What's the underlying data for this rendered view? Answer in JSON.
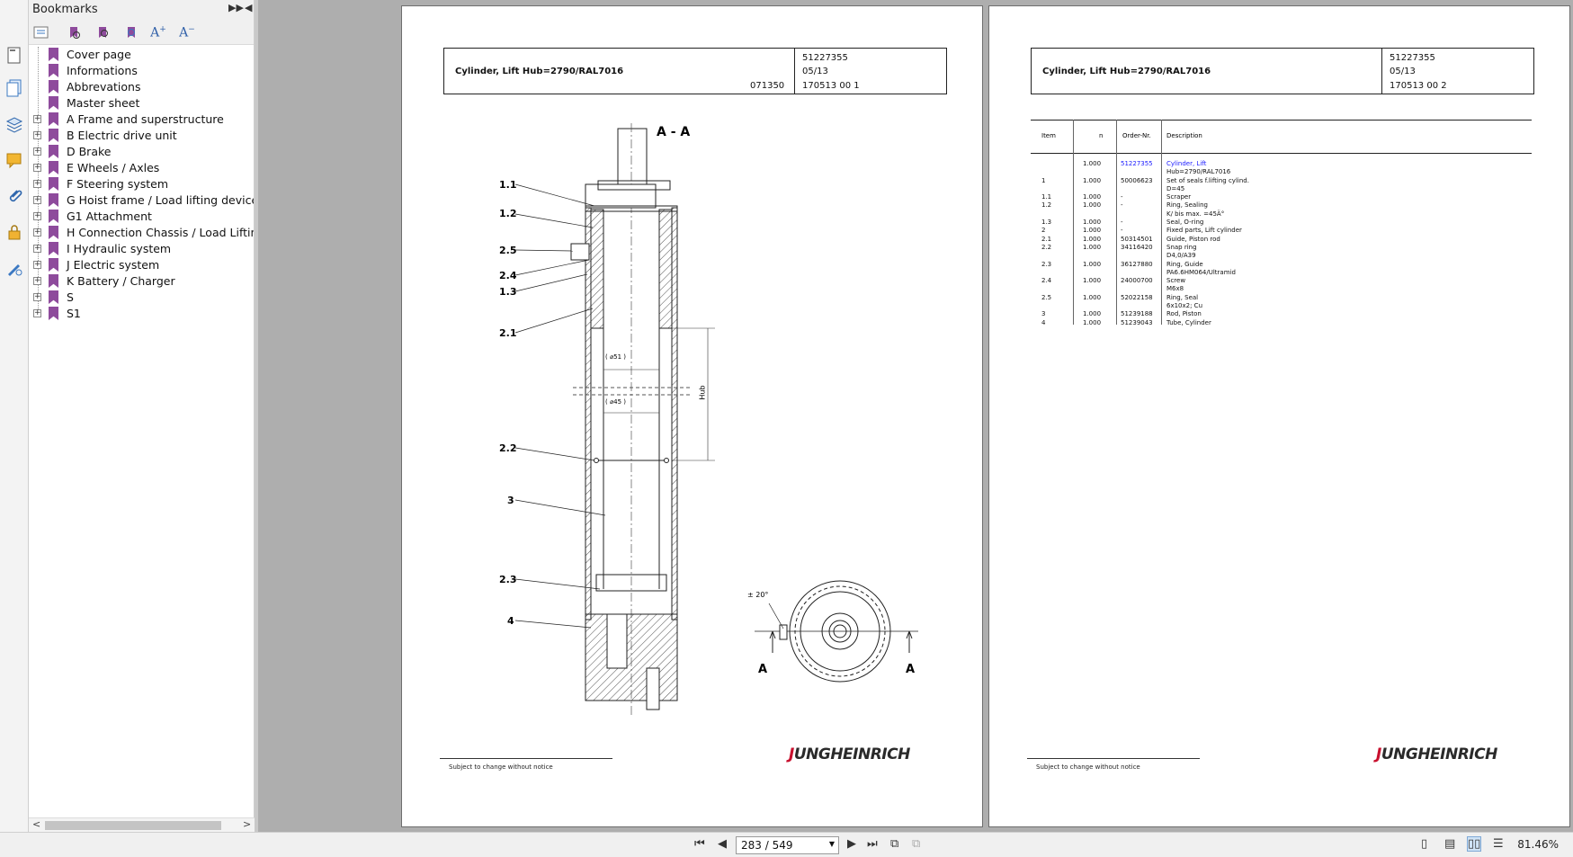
{
  "panel": {
    "title": "Bookmarks"
  },
  "bookmarks": [
    {
      "label": "Cover page",
      "expandable": false
    },
    {
      "label": "Informations",
      "expandable": false
    },
    {
      "label": "Abbrevations",
      "expandable": false
    },
    {
      "label": "Master sheet",
      "expandable": false
    },
    {
      "label": "A Frame and superstructure",
      "expandable": true
    },
    {
      "label": "B Electric drive unit",
      "expandable": true
    },
    {
      "label": "D Brake",
      "expandable": true
    },
    {
      "label": "E Wheels / Axles",
      "expandable": true
    },
    {
      "label": "F Steering system",
      "expandable": true
    },
    {
      "label": "G Hoist frame / Load lifting device",
      "expandable": true
    },
    {
      "label": "G1 Attachment",
      "expandable": true
    },
    {
      "label": "H Connection Chassis / Load Lifting De",
      "expandable": true
    },
    {
      "label": "I Hydraulic system",
      "expandable": true
    },
    {
      "label": "J Electric system",
      "expandable": true
    },
    {
      "label": "K Battery / Charger",
      "expandable": true
    },
    {
      "label": "S",
      "expandable": true
    },
    {
      "label": "S1",
      "expandable": true
    }
  ],
  "left_page": {
    "title": "Cylinder, Lift Hub=2790/RAL7016",
    "code_left": "071350",
    "part_no": "51227355",
    "date": "05/13",
    "sheet": "170513 00 1",
    "section": "A - A",
    "callouts": [
      "1.1",
      "1.2",
      "2.5",
      "2.4",
      "1.3",
      "2.1",
      "2.2",
      "3",
      "2.3",
      "4"
    ],
    "dim_51": "( ⌀51 )",
    "dim_45": "( ⌀45 )",
    "dim_hub": "Hub",
    "angle": "± 20°",
    "cut_a": "A",
    "footer": "Subject to change without notice"
  },
  "right_page": {
    "title": "Cylinder, Lift Hub=2790/RAL7016",
    "part_no": "51227355",
    "date": "05/13",
    "sheet": "170513 00 2",
    "footer": "Subject to change without notice",
    "columns": [
      "Item",
      "n",
      "Order-Nr.",
      "Description"
    ],
    "rows": [
      {
        "item": "",
        "n": "1.000",
        "order": "51227355",
        "desc": "Cylinder, Lift",
        "link": true
      },
      {
        "item": "",
        "n": "",
        "order": "",
        "desc": "Hub=2790/RAL7016",
        "link": false
      },
      {
        "item": "1",
        "n": "1.000",
        "order": "50006623",
        "desc": "Set of seals f.lifting cylind.",
        "link": false
      },
      {
        "item": "",
        "n": "",
        "order": "",
        "desc": "D=45",
        "link": false
      },
      {
        "item": "1.1",
        "n": "1.000",
        "order": "-",
        "desc": "Scraper",
        "link": false
      },
      {
        "item": "1.2",
        "n": "1.000",
        "order": "-",
        "desc": "Ring, Sealing",
        "link": false
      },
      {
        "item": "",
        "n": "",
        "order": "",
        "desc": "K/ bis max. =45Ä°",
        "link": false
      },
      {
        "item": "1.3",
        "n": "1.000",
        "order": "-",
        "desc": "Seal, O-ring",
        "link": false
      },
      {
        "item": "2",
        "n": "1.000",
        "order": "-",
        "desc": "Fixed parts, Lift cylinder",
        "link": false
      },
      {
        "item": "2.1",
        "n": "1.000",
        "order": "50314501",
        "desc": "Guide, Piston rod",
        "link": false
      },
      {
        "item": "2.2",
        "n": "1.000",
        "order": "34116420",
        "desc": "Snap ring",
        "link": false
      },
      {
        "item": "",
        "n": "",
        "order": "",
        "desc": "D4,0/A39",
        "link": false
      },
      {
        "item": "2.3",
        "n": "1.000",
        "order": "36127880",
        "desc": "Ring, Guide",
        "link": false
      },
      {
        "item": "",
        "n": "",
        "order": "",
        "desc": "PA6.6HM064/Ultramid",
        "link": false
      },
      {
        "item": "2.4",
        "n": "1.000",
        "order": "24000700",
        "desc": "Screw",
        "link": false
      },
      {
        "item": "",
        "n": "",
        "order": "",
        "desc": "M6x8",
        "link": false
      },
      {
        "item": "2.5",
        "n": "1.000",
        "order": "52022158",
        "desc": "Ring, Seal",
        "link": false
      },
      {
        "item": "",
        "n": "",
        "order": "",
        "desc": "6x10x2; Cu",
        "link": false
      },
      {
        "item": "3",
        "n": "1.000",
        "order": "51239188",
        "desc": "Rod, Piston",
        "link": false
      },
      {
        "item": "4",
        "n": "1.000",
        "order": "51239043",
        "desc": "Tube, Cylinder",
        "link": false
      }
    ]
  },
  "brand": {
    "logo_j": "J",
    "logo_rest": "UNGHEINRICH"
  },
  "nav": {
    "page_field": "283 / 549",
    "zoom": "81.46%"
  },
  "colors": {
    "bookmark": "#8e4b9c",
    "brand_red": "#c8102e",
    "link_blue": "#1a1aff"
  }
}
